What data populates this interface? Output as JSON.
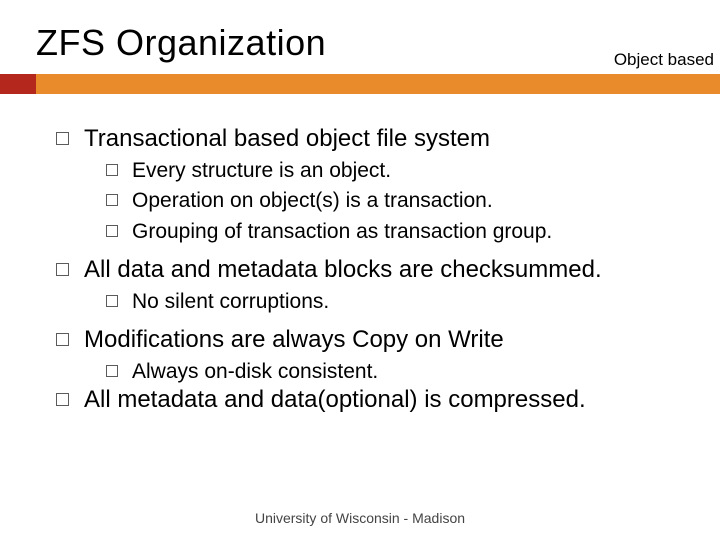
{
  "title": "ZFS Organization",
  "corner_label": "Object based",
  "items": {
    "p1": "Transactional based object file system",
    "p1a": "Every structure is an object.",
    "p1b": "Operation on object(s) is a transaction.",
    "p1c": "Grouping of transaction as transaction group.",
    "p2": "All data and metadata blocks are checksummed.",
    "p2a": "No silent corruptions.",
    "p3": "Modifications are always Copy on Write",
    "p3a": "Always on-disk consistent.",
    "p4": "All metadata and data(optional) is compressed."
  },
  "footer": "University of Wisconsin - Madison"
}
